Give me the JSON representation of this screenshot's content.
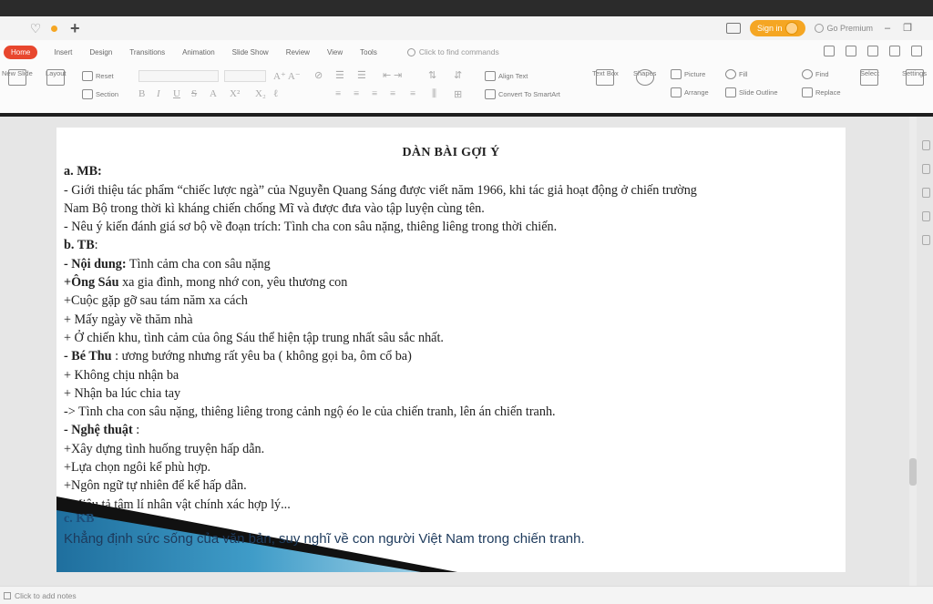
{
  "titlebar": {
    "sign_in": "Sign in",
    "premium": "Go Premium"
  },
  "menu": {
    "tabs": [
      "Home",
      "Insert",
      "Design",
      "Transitions",
      "Animation",
      "Slide Show",
      "Review",
      "View",
      "Tools"
    ],
    "find_placeholder": "Click to find commands"
  },
  "ribbon": {
    "new_slide": "New Slide",
    "layout": "Layout",
    "reset": "Reset",
    "section": "Section",
    "align_text": "Align Text",
    "convert_smartart": "Convert To SmartArt",
    "text_box": "Text Box",
    "shapes": "Shapes",
    "picture": "Picture",
    "arrange": "Arrange",
    "fill": "Fill",
    "outline": "Slide Outline",
    "find": "Find",
    "replace": "Replace",
    "select": "Select",
    "settings": "Settings"
  },
  "slide": {
    "title": "DÀN BÀI GỢI Ý",
    "lines": [
      {
        "bold": "a. MB:",
        "text": ""
      },
      {
        "bold": "",
        "text": "- Giới thiệu tác phẩm “chiếc lược ngà” của Nguyễn Quang Sáng được viết năm 1966, khi tác giả hoạt động ở chiến trường"
      },
      {
        "bold": "",
        "text": "Nam Bộ trong thời kì kháng chiến chống Mĩ và được đưa vào tập luyện cùng tên."
      },
      {
        "bold": "",
        "text": "- Nêu ý kiến đánh giá sơ bộ về đoạn trích: Tình cha con sâu nặng, thiêng liêng trong thời chiến."
      },
      {
        "bold": "b. TB",
        "text": ":"
      },
      {
        "bold": "- Nội dung:",
        "text": " Tình cảm cha con sâu nặng"
      },
      {
        "bold": "+Ông Sáu",
        "text": " xa gia đình, mong nhớ con, yêu thương con"
      },
      {
        "bold": "",
        "text": "+Cuộc gặp gỡ sau tám năm xa cách"
      },
      {
        "bold": "",
        "text": "+ Mấy ngày về thăm nhà"
      },
      {
        "bold": "",
        "text": "+ Ở chiến khu, tình cảm của ông Sáu thể hiện tập trung nhất sâu sắc nhất."
      },
      {
        "bold": "- Bé Thu",
        "text": " : ương bướng nhưng rất yêu ba ( không gọi ba, ôm cổ ba)"
      },
      {
        "bold": "",
        "text": "+ Không chịu nhận ba"
      },
      {
        "bold": "",
        "text": "+ Nhận ba lúc chia tay"
      },
      {
        "bold": "",
        "text": "-> Tình cha con sâu nặng, thiêng liêng trong cảnh ngộ éo le của chiến tranh, lên án chiến tranh."
      },
      {
        "bold": "- Nghệ thuật",
        "text": " :"
      },
      {
        "bold": "",
        "text": "+Xây dựng tình huống truyện hấp dẫn."
      },
      {
        "bold": "",
        "text": "+Lựa chọn ngôi kể phù hợp."
      },
      {
        "bold": "",
        "text": "+Ngôn ngữ tự nhiên để kể hấp dẫn."
      },
      {
        "bold": "",
        "text": "+Miêu tả tâm lí nhân vật chính xác hợp lý..."
      }
    ],
    "section_c": "c. KB",
    "conclusion": "Khẳng định sức sống của văn bản, suy nghĩ  về con người Việt Nam trong chiến tranh."
  },
  "status": {
    "notes": "Click to add notes"
  },
  "colors": {
    "accent": "#e8472e",
    "signin": "#f5a623",
    "slide_deco_blue": "#1f7aa8",
    "slide_deco_dark": "#111111"
  }
}
